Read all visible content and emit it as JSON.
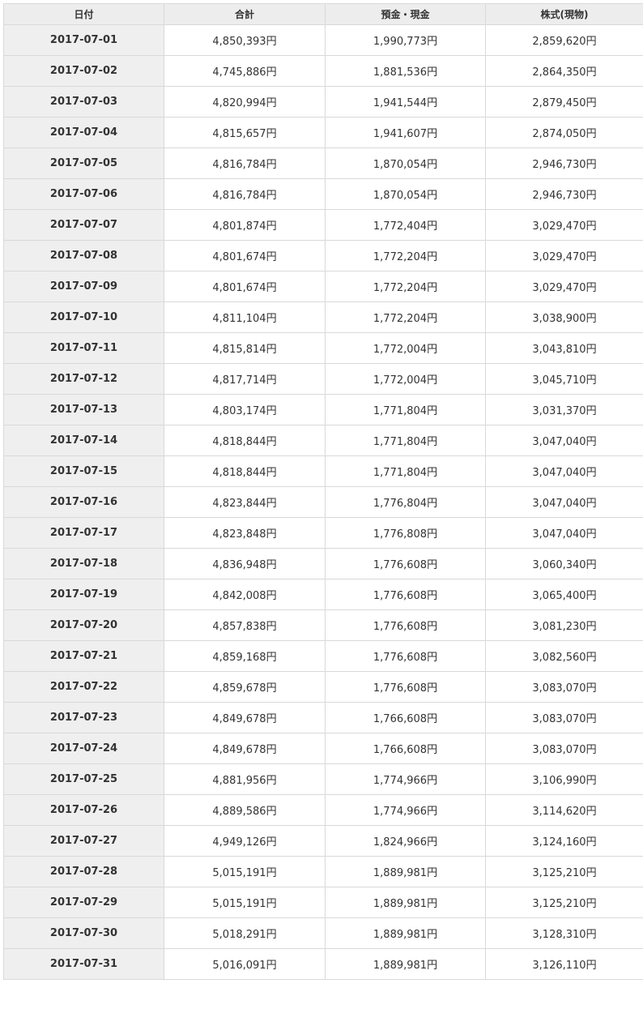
{
  "table": {
    "headers": [
      "日付",
      "合計",
      "預金・現金",
      "株式(現物)"
    ],
    "rows": [
      [
        "2017-07-01",
        "4,850,393円",
        "1,990,773円",
        "2,859,620円"
      ],
      [
        "2017-07-02",
        "4,745,886円",
        "1,881,536円",
        "2,864,350円"
      ],
      [
        "2017-07-03",
        "4,820,994円",
        "1,941,544円",
        "2,879,450円"
      ],
      [
        "2017-07-04",
        "4,815,657円",
        "1,941,607円",
        "2,874,050円"
      ],
      [
        "2017-07-05",
        "4,816,784円",
        "1,870,054円",
        "2,946,730円"
      ],
      [
        "2017-07-06",
        "4,816,784円",
        "1,870,054円",
        "2,946,730円"
      ],
      [
        "2017-07-07",
        "4,801,874円",
        "1,772,404円",
        "3,029,470円"
      ],
      [
        "2017-07-08",
        "4,801,674円",
        "1,772,204円",
        "3,029,470円"
      ],
      [
        "2017-07-09",
        "4,801,674円",
        "1,772,204円",
        "3,029,470円"
      ],
      [
        "2017-07-10",
        "4,811,104円",
        "1,772,204円",
        "3,038,900円"
      ],
      [
        "2017-07-11",
        "4,815,814円",
        "1,772,004円",
        "3,043,810円"
      ],
      [
        "2017-07-12",
        "4,817,714円",
        "1,772,004円",
        "3,045,710円"
      ],
      [
        "2017-07-13",
        "4,803,174円",
        "1,771,804円",
        "3,031,370円"
      ],
      [
        "2017-07-14",
        "4,818,844円",
        "1,771,804円",
        "3,047,040円"
      ],
      [
        "2017-07-15",
        "4,818,844円",
        "1,771,804円",
        "3,047,040円"
      ],
      [
        "2017-07-16",
        "4,823,844円",
        "1,776,804円",
        "3,047,040円"
      ],
      [
        "2017-07-17",
        "4,823,848円",
        "1,776,808円",
        "3,047,040円"
      ],
      [
        "2017-07-18",
        "4,836,948円",
        "1,776,608円",
        "3,060,340円"
      ],
      [
        "2017-07-19",
        "4,842,008円",
        "1,776,608円",
        "3,065,400円"
      ],
      [
        "2017-07-20",
        "4,857,838円",
        "1,776,608円",
        "3,081,230円"
      ],
      [
        "2017-07-21",
        "4,859,168円",
        "1,776,608円",
        "3,082,560円"
      ],
      [
        "2017-07-22",
        "4,859,678円",
        "1,776,608円",
        "3,083,070円"
      ],
      [
        "2017-07-23",
        "4,849,678円",
        "1,766,608円",
        "3,083,070円"
      ],
      [
        "2017-07-24",
        "4,849,678円",
        "1,766,608円",
        "3,083,070円"
      ],
      [
        "2017-07-25",
        "4,881,956円",
        "1,774,966円",
        "3,106,990円"
      ],
      [
        "2017-07-26",
        "4,889,586円",
        "1,774,966円",
        "3,114,620円"
      ],
      [
        "2017-07-27",
        "4,949,126円",
        "1,824,966円",
        "3,124,160円"
      ],
      [
        "2017-07-28",
        "5,015,191円",
        "1,889,981円",
        "3,125,210円"
      ],
      [
        "2017-07-29",
        "5,015,191円",
        "1,889,981円",
        "3,125,210円"
      ],
      [
        "2017-07-30",
        "5,018,291円",
        "1,889,981円",
        "3,128,310円"
      ],
      [
        "2017-07-31",
        "5,016,091円",
        "1,889,981円",
        "3,126,110円"
      ]
    ]
  }
}
